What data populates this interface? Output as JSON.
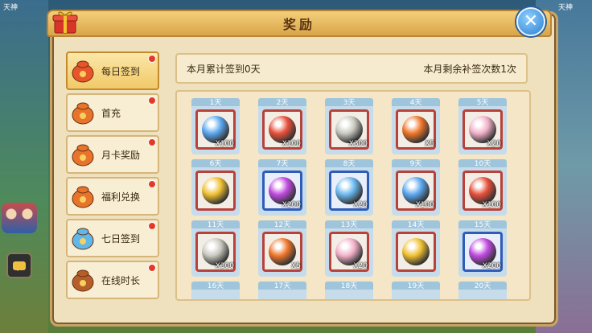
{
  "panel": {
    "title": "奖励"
  },
  "background": {
    "left_name": "天神",
    "right_name": "天神"
  },
  "sidebar": {
    "items": [
      {
        "label": "每日签到",
        "active": true,
        "dot": true,
        "icon": "red-pouch-icon",
        "color": "#e8552a"
      },
      {
        "label": "首充",
        "active": false,
        "dot": true,
        "icon": "money-bag-icon",
        "color": "#e8732a"
      },
      {
        "label": "月卡奖励",
        "active": false,
        "dot": true,
        "icon": "money-bag-icon",
        "color": "#e8732a"
      },
      {
        "label": "福利兑换",
        "active": false,
        "dot": true,
        "icon": "money-bag-icon",
        "color": "#e8732a"
      },
      {
        "label": "七日签到",
        "active": false,
        "dot": true,
        "icon": "ingot-icon",
        "color": "#5fb8e8"
      },
      {
        "label": "在线时长",
        "active": false,
        "dot": true,
        "icon": "crystal-egg-icon",
        "color": "#b45f2a"
      }
    ]
  },
  "summary": {
    "left": "本月累计签到0天",
    "right": "本月剩余补签次数1次"
  },
  "rewards": [
    {
      "day": "1天",
      "qty": "X100",
      "item": "blue-orb-icon",
      "color": "#5aa8f0",
      "frame": "red"
    },
    {
      "day": "2天",
      "qty": "X100",
      "item": "red-orb-icon",
      "color": "#e8503a",
      "frame": "red"
    },
    {
      "day": "3天",
      "qty": "X300",
      "item": "silver-orb-icon",
      "color": "#c9c9c0",
      "frame": "red"
    },
    {
      "day": "4天",
      "qty": "X5",
      "item": "fire-pouch-icon",
      "color": "#f0762a",
      "frame": "red"
    },
    {
      "day": "5天",
      "qty": "X20",
      "item": "pet-bag-icon",
      "color": "#f2b0c8",
      "frame": "red"
    },
    {
      "day": "6天",
      "qty": "",
      "item": "gold-coin-icon",
      "color": "#f0c030",
      "frame": "red"
    },
    {
      "day": "7天",
      "qty": "X200",
      "item": "purple-orb-icon",
      "color": "#c04ae0",
      "frame": "blue"
    },
    {
      "day": "8天",
      "qty": "X20",
      "item": "blue-egg-icon",
      "color": "#6ab8f0",
      "frame": "blue"
    },
    {
      "day": "9天",
      "qty": "X100",
      "item": "blue-orb-icon",
      "color": "#5aa8f0",
      "frame": "red"
    },
    {
      "day": "10天",
      "qty": "X100",
      "item": "red-orb-icon",
      "color": "#e8503a",
      "frame": "red"
    },
    {
      "day": "11天",
      "qty": "X300",
      "item": "silver-orb-icon",
      "color": "#c9c9c0",
      "frame": "red"
    },
    {
      "day": "12天",
      "qty": "X5",
      "item": "fire-pouch-icon",
      "color": "#f0762a",
      "frame": "red"
    },
    {
      "day": "13天",
      "qty": "X20",
      "item": "pet-bag-icon",
      "color": "#f2b0c8",
      "frame": "red"
    },
    {
      "day": "14天",
      "qty": "",
      "item": "gold-coin-icon",
      "color": "#f0c030",
      "frame": "red"
    },
    {
      "day": "15天",
      "qty": "X200",
      "item": "purple-orb-icon",
      "color": "#c04ae0",
      "frame": "blue"
    },
    {
      "day": "16天",
      "qty": "",
      "item": "",
      "color": "",
      "frame": "none"
    },
    {
      "day": "17天",
      "qty": "",
      "item": "",
      "color": "",
      "frame": "none"
    },
    {
      "day": "18天",
      "qty": "",
      "item": "",
      "color": "",
      "frame": "none"
    },
    {
      "day": "19天",
      "qty": "",
      "item": "",
      "color": "",
      "frame": "none"
    },
    {
      "day": "20天",
      "qty": "",
      "item": "",
      "color": "",
      "frame": "none"
    }
  ]
}
